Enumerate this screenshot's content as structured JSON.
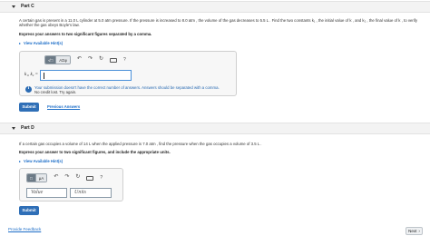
{
  "partC": {
    "title": "Part C",
    "problem": "A certain gas is present in a 11.0 L cylinder at 5.0 atm pressure. If the pressure is increased to 8.0 atm , the volume of the gas decreases to 5.5 L . Find the two constants k₁ , the initial value of k , and k₂ , the final value of k , to verify",
    "problem2": "whether the gas obeys Boyle's law.",
    "instruction": "Express your answers to two significant figures separated by a comma.",
    "hints_link": "View Available Hint(s)",
    "toolbar": {
      "btn1": "√□",
      "btn2": "AΣφ",
      "help": "?"
    },
    "answer_label": "k₁, k₂ =",
    "answer_value": "",
    "feedback_message": "Your submission doesn't have the correct number of answers. Answers should be separated with a comma.",
    "feedback_sub": "No credit lost. Try again.",
    "submit_label": "Submit",
    "previous_answers_label": "Previous Answers"
  },
  "partD": {
    "title": "Part D",
    "problem": "If a certain gas occupies a volume of 14 L when the applied pressure is 7.0 atm , find the pressure when the gas occupies a volume of 3.5 L .",
    "instruction": "Express your answer to two significant figures, and include the appropriate units.",
    "hints_link": "View Available Hint(s)",
    "toolbar": {
      "btn1": "□",
      "btn2": "μA",
      "help": "?"
    },
    "value_placeholder": "Value",
    "units_placeholder": "Units",
    "submit_label": "Submit"
  },
  "footer": {
    "feedback_link": "Provide Feedback",
    "next_label": "Next"
  }
}
